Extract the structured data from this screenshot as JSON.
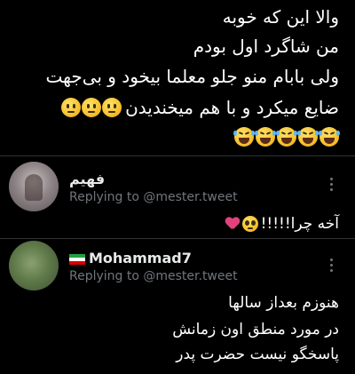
{
  "tweet": {
    "lines": [
      "والا این که خوبه",
      "من شاگرد اول بودم",
      "ولی بابام منو جلو معلما بیخود و بی‌جهت",
      "ضایع میکرد و با هم میخندیدن"
    ],
    "line4_emoji": [
      "neutral-face-icon",
      "neutral-face-icon",
      "neutral-face-icon"
    ],
    "emoji_row": [
      "laughing-tears-icon",
      "laughing-tears-icon",
      "laughing-tears-icon",
      "laughing-tears-icon",
      "laughing-tears-icon"
    ]
  },
  "replies": [
    {
      "name": "فهیم",
      "replying_to": "Replying to @mester.tweet",
      "text": "آخه چرا!!!!!",
      "emoji": [
        "pleading-face-icon",
        "broken-heart-icon"
      ]
    },
    {
      "name": "Mohammad7",
      "flag": "iran-flag-icon",
      "replying_to": "Replying to @mester.tweet",
      "text_lines": [
        "هنوزم بعداز سالها",
        "در مورد منطق اون زمانش",
        "پاسخگو نیست حضرت پدر"
      ]
    }
  ],
  "colors": {
    "background": "#000000",
    "text": "#ffffff",
    "secondary": "#71767b",
    "divider": "#2f3336"
  }
}
